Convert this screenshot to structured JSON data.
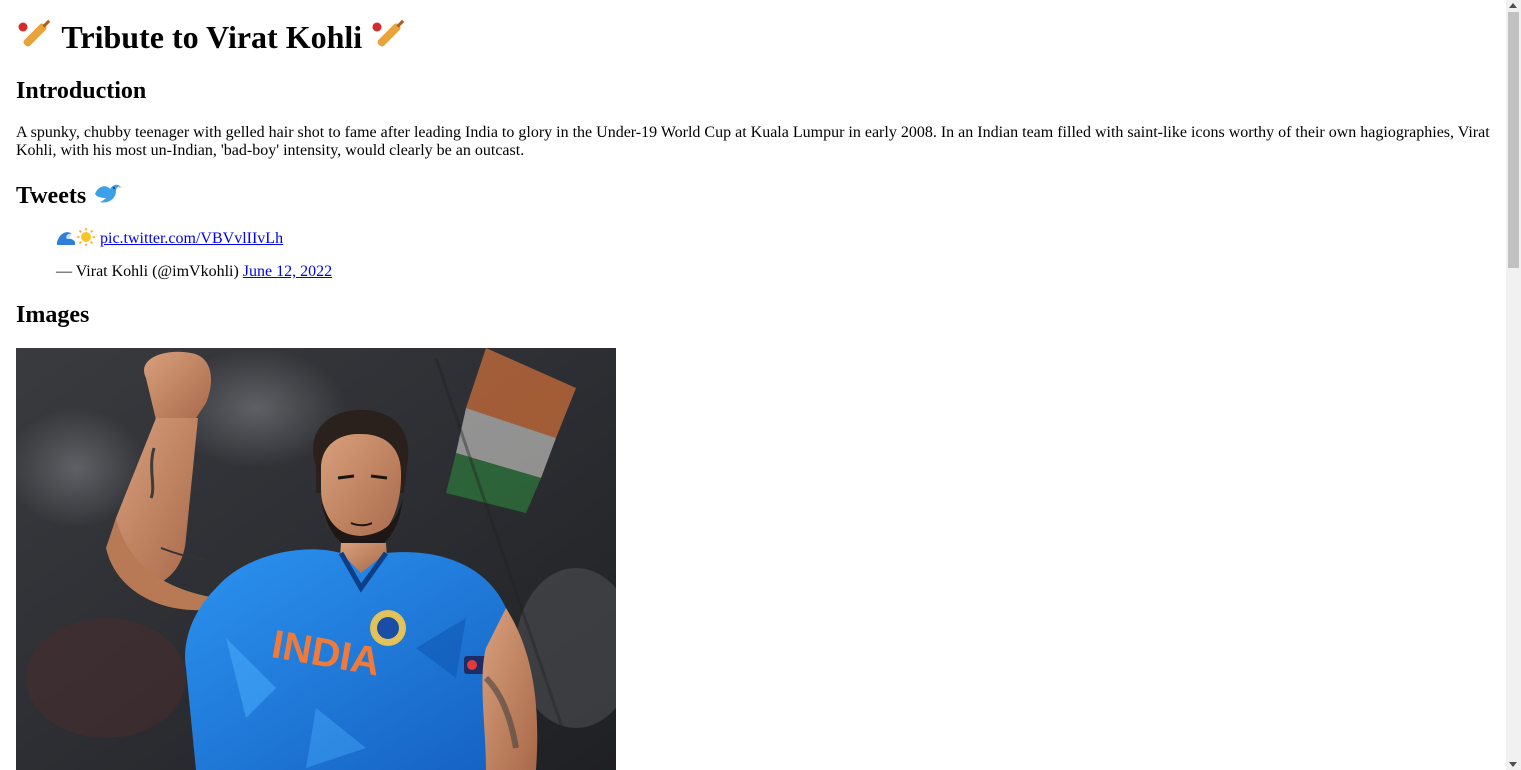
{
  "page": {
    "title": "Tribute to Virat Kohli",
    "title_icon": "cricket-bat-icon"
  },
  "introduction": {
    "heading": "Introduction",
    "text": "A spunky, chubby teenager with gelled hair shot to fame after leading India to glory in the Under-19 World Cup at Kuala Lumpur in early 2008. In an Indian team filled with saint-like icons worthy of their own hagiographies, Virat Kohli, with his most un-Indian, 'bad-boy' intensity, would clearly be an outcast."
  },
  "tweets": {
    "heading": "Tweets",
    "heading_icon": "bird-icon",
    "items": [
      {
        "emojis": [
          "wave-icon",
          "sun-icon"
        ],
        "link_text": "pic.twitter.com/VBVvlIIvLh",
        "attribution": "— Virat Kohli (@imVkohli)",
        "date_text": "June 12, 2022"
      }
    ]
  },
  "images": {
    "heading": "Images",
    "photo_alt": "Virat Kohli celebrating in India jersey",
    "jersey_text": "INDIA"
  },
  "colors": {
    "link": "#0000ee",
    "jersey_blue": "#1e7fe0",
    "jersey_text": "#f07a3a"
  }
}
